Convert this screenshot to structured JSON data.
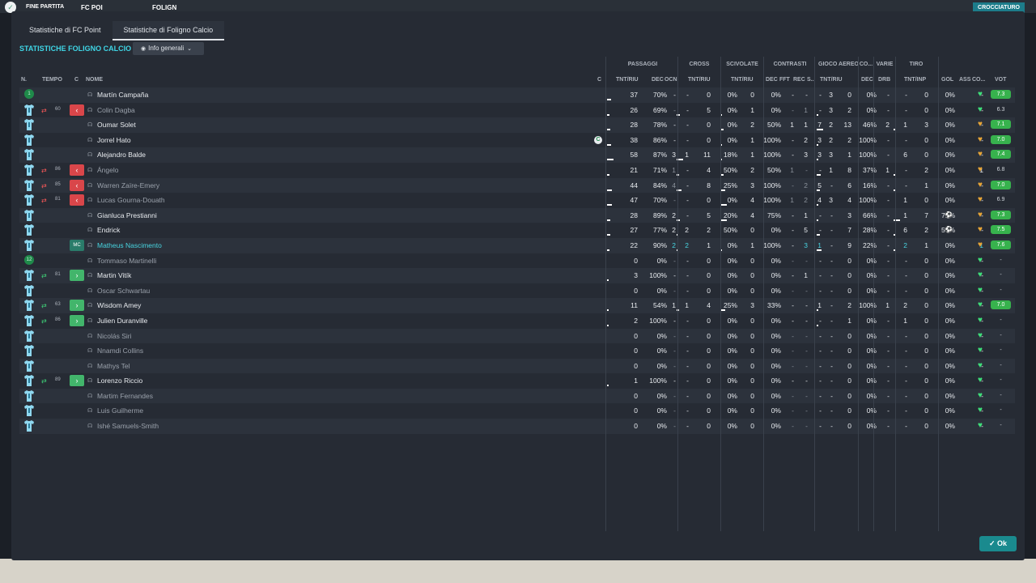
{
  "topbar": {
    "title": "FINE PARTITA",
    "home": "FC POI",
    "score": "",
    "away": "FOLIGN",
    "right_btn": "CROCCIATURO"
  },
  "tabs": [
    {
      "label": "Statistiche di FC Point",
      "active": false
    },
    {
      "label": "Statistiche di Foligno Calcio",
      "active": true
    }
  ],
  "section_title": "STATISTICHE FOLIGNO CALCIO",
  "filter": {
    "label": "Info generali"
  },
  "groups": [
    "PASSAGGI",
    "CROSS",
    "SCIVOLATE",
    "CONTRASTI",
    "GIOCO AEREO",
    "CO...",
    "VARIE",
    "TIRO"
  ],
  "columns": {
    "n": "N.",
    "tempo": "TEMPO",
    "c1": "C",
    "nome": "NOME",
    "c2": "C",
    "tntriu1": "TNT/RIU",
    "dec1": "DEC",
    "ocn": "OCN",
    "tntriu2": "TNT/RIU",
    "tntriu3": "TNT/RIU",
    "dec2": "DEC",
    "fft": "FFT",
    "rec": "REC",
    "s": "S...",
    "tntriu4": "TNT/RIU",
    "dec3": "DEC",
    "drb": "DRB",
    "tntinp": "TNT/INP",
    "gol": "GOL",
    "ass": "ASS",
    "co": "CO...",
    "vot": "VOT"
  },
  "players": [
    {
      "shirt": "gk",
      "gk_no": "1",
      "name": "Martín Campaña",
      "style": "",
      "captain": false,
      "sub": "",
      "min": "",
      "p": "37",
      "pp": "70%",
      "dec": "-",
      "ocn": "-",
      "cr": "0",
      "crp": "0%",
      "sc": "0",
      "scp": "0%",
      "cdec": "-",
      "cfft": "-",
      "crec": "-",
      "cs": "3",
      "ga": "0",
      "gap": "0%",
      "co": "-",
      "drb": "-",
      "t": "0",
      "tp": "0%",
      "gol": "",
      "ass": "-",
      "heart": "g",
      "vot": "7.3",
      "vhi": true
    },
    {
      "shirt": "p",
      "name": "Colin Dagba",
      "style": "dim",
      "captain": false,
      "sub": "out",
      "min": "60",
      "p": "26",
      "pp": "69%",
      "dec": "-",
      "ocn": "-",
      "cr": "5",
      "crp": "0%",
      "sc": "1",
      "scp": "0%",
      "cdec": "-",
      "cfft": "1",
      "crec": "-",
      "cs": "3",
      "ga": "2",
      "gap": "0%",
      "co": "-",
      "drb": "-",
      "t": "0",
      "tp": "0%",
      "gol": "",
      "ass": "-",
      "heart": "g",
      "vot": "6.3",
      "vhi": false
    },
    {
      "shirt": "p",
      "name": "Oumar Solet",
      "style": "",
      "captain": false,
      "sub": "",
      "min": "",
      "p": "28",
      "pp": "78%",
      "dec": "-",
      "ocn": "-",
      "cr": "0",
      "crp": "0%",
      "sc": "2",
      "scp": "50%",
      "cdec": "1",
      "cfft": "1",
      "crec": "7",
      "cs": "2",
      "ga": "13",
      "gap": "46%",
      "co": "2",
      "drb": "1",
      "t": "3",
      "tp": "0%",
      "gol": "",
      "ass": "-",
      "heart": "o",
      "vot": "7.1",
      "vhi": true
    },
    {
      "shirt": "p",
      "name": "Jorrel Hato",
      "style": "",
      "captain": true,
      "sub": "",
      "min": "",
      "p": "38",
      "pp": "86%",
      "dec": "-",
      "ocn": "-",
      "cr": "0",
      "crp": "0%",
      "sc": "1",
      "scp": "100%",
      "cdec": "-",
      "cfft": "2",
      "crec": "3",
      "cs": "2",
      "ga": "2",
      "gap": "100%",
      "co": "-",
      "drb": "-",
      "t": "0",
      "tp": "0%",
      "gol": "",
      "ass": "-",
      "heart": "o",
      "vot": "7.0",
      "vhi": true
    },
    {
      "shirt": "p",
      "name": "Alejandro Balde",
      "style": "",
      "captain": false,
      "sub": "",
      "min": "",
      "p": "58",
      "pp": "87%",
      "dec": "3",
      "ocn": "1",
      "cr": "11",
      "crp": "18%",
      "sc": "1",
      "scp": "100%",
      "cdec": "-",
      "cfft": "3",
      "crec": "3",
      "cs": "3",
      "ga": "1",
      "gap": "100%",
      "co": "-",
      "drb": "6",
      "t": "0",
      "tp": "0%",
      "gol": "",
      "ass": "-",
      "heart": "o",
      "vot": "7.4",
      "vhi": true
    },
    {
      "shirt": "p",
      "name": "Ángelo",
      "style": "dim",
      "captain": false,
      "sub": "out",
      "min": "86",
      "p": "21",
      "pp": "71%",
      "dec": "1",
      "ocn": "-",
      "cr": "4",
      "crp": "50%",
      "sc": "2",
      "scp": "50%",
      "cdec": "1",
      "cfft": "-",
      "crec": "-",
      "cs": "1",
      "ga": "8",
      "gap": "37%",
      "co": "1",
      "drb": "-",
      "t": "2",
      "tp": "0%",
      "gol": "",
      "ass": "1",
      "heart": "o",
      "vot": "6.8",
      "vhi": false
    },
    {
      "shirt": "p",
      "name": "Warren Zaïre-Emery",
      "style": "dim",
      "captain": false,
      "sub": "out",
      "min": "85",
      "p": "44",
      "pp": "84%",
      "dec": "4",
      "ocn": "-",
      "cr": "8",
      "crp": "25%",
      "sc": "3",
      "scp": "100%",
      "cdec": "-",
      "cfft": "2",
      "crec": "5",
      "cs": "-",
      "ga": "6",
      "gap": "16%",
      "co": "-",
      "drb": "-",
      "t": "1",
      "tp": "0%",
      "gol": "",
      "ass": "-",
      "heart": "o",
      "vot": "7.0",
      "vhi": true
    },
    {
      "shirt": "p",
      "name": "Lucas Gourna-Douath",
      "style": "dim",
      "captain": false,
      "sub": "out",
      "min": "81",
      "p": "47",
      "pp": "70%",
      "dec": "-",
      "ocn": "-",
      "cr": "0",
      "crp": "0%",
      "sc": "4",
      "scp": "100%",
      "cdec": "1",
      "cfft": "2",
      "crec": "4",
      "cs": "3",
      "ga": "4",
      "gap": "100%",
      "co": "-",
      "drb": "1",
      "t": "0",
      "tp": "0%",
      "gol": "",
      "ass": "-",
      "heart": "o",
      "vot": "6.9",
      "vhi": false
    },
    {
      "shirt": "p",
      "name": "Gianluca Prestianni",
      "style": "",
      "captain": false,
      "sub": "",
      "min": "",
      "p": "28",
      "pp": "89%",
      "dec": "2",
      "ocn": "-",
      "cr": "5",
      "crp": "20%",
      "sc": "4",
      "scp": "75%",
      "cdec": "-",
      "cfft": "1",
      "crec": "-",
      "cs": "-",
      "ga": "3",
      "gap": "66%",
      "co": "-",
      "drb": "1",
      "t": "7",
      "tp": "71%",
      "gol": "ball",
      "ass": "-",
      "heart": "o",
      "vot": "7.3",
      "vhi": true
    },
    {
      "shirt": "p",
      "name": "Endrick",
      "style": "",
      "captain": false,
      "sub": "",
      "min": "",
      "p": "27",
      "pp": "77%",
      "dec": "2",
      "ocn": "2",
      "cr": "2",
      "crp": "50%",
      "sc": "0",
      "scp": "0%",
      "cdec": "-",
      "cfft": "5",
      "crec": "-",
      "cs": "-",
      "ga": "7",
      "gap": "28%",
      "co": "-",
      "drb": "6",
      "t": "2",
      "tp": "50%",
      "gol": "ball",
      "ass": "-",
      "heart": "o",
      "vot": "7.5",
      "vhi": true
    },
    {
      "shirt": "p",
      "name": "Matheus Nascimento",
      "style": "cyan",
      "captain": false,
      "sub": "mc",
      "min": "",
      "p": "22",
      "pp": "90%",
      "dec": "2",
      "ocn": "2",
      "cr": "1",
      "crp": "0%",
      "sc": "1",
      "scp": "100%",
      "cdec": "-",
      "cfft": "3",
      "crec": "1",
      "cs": "-",
      "ga": "9",
      "gap": "22%",
      "co": "-",
      "drb": "2",
      "t": "1",
      "tp": "0%",
      "gol": "",
      "ass": "1",
      "heart": "o",
      "vot": "7.6",
      "vhi": true
    },
    {
      "shirt": "gk",
      "gk_no": "12",
      "name": "Tommaso Martinelli",
      "style": "dim",
      "captain": false,
      "sub": "",
      "min": "",
      "p": "0",
      "pp": "0%",
      "dec": "-",
      "ocn": "-",
      "cr": "0",
      "crp": "0%",
      "sc": "0",
      "scp": "0%",
      "cdec": "-",
      "cfft": "-",
      "crec": "-",
      "cs": "-",
      "ga": "0",
      "gap": "0%",
      "co": "-",
      "drb": "-",
      "t": "0",
      "tp": "0%",
      "gol": "",
      "ass": "-",
      "heart": "g",
      "vot": "-",
      "vhi": false
    },
    {
      "shirt": "p",
      "name": "Martin Vitík",
      "style": "",
      "captain": false,
      "sub": "in",
      "min": "81",
      "p": "3",
      "pp": "100%",
      "dec": "-",
      "ocn": "-",
      "cr": "0",
      "crp": "0%",
      "sc": "0",
      "scp": "0%",
      "cdec": "-",
      "cfft": "1",
      "crec": "-",
      "cs": "-",
      "ga": "0",
      "gap": "0%",
      "co": "-",
      "drb": "-",
      "t": "0",
      "tp": "0%",
      "gol": "",
      "ass": "-",
      "heart": "g",
      "vot": "-",
      "vhi": false
    },
    {
      "shirt": "p",
      "name": "Oscar Schwartau",
      "style": "dim",
      "captain": false,
      "sub": "",
      "min": "",
      "p": "0",
      "pp": "0%",
      "dec": "-",
      "ocn": "-",
      "cr": "0",
      "crp": "0%",
      "sc": "0",
      "scp": "0%",
      "cdec": "-",
      "cfft": "-",
      "crec": "-",
      "cs": "-",
      "ga": "0",
      "gap": "0%",
      "co": "-",
      "drb": "-",
      "t": "0",
      "tp": "0%",
      "gol": "",
      "ass": "-",
      "heart": "g",
      "vot": "-",
      "vhi": false
    },
    {
      "shirt": "p",
      "name": "Wisdom Amey",
      "style": "",
      "captain": false,
      "sub": "in",
      "min": "63",
      "p": "11",
      "pp": "54%",
      "dec": "1",
      "ocn": "1",
      "cr": "4",
      "crp": "25%",
      "sc": "3",
      "scp": "33%",
      "cdec": "-",
      "cfft": "-",
      "crec": "1",
      "cs": "-",
      "ga": "2",
      "gap": "100%",
      "co": "1",
      "drb": "2",
      "t": "0",
      "tp": "0%",
      "gol": "",
      "ass": "-",
      "heart": "g",
      "vot": "7.0",
      "vhi": true
    },
    {
      "shirt": "p",
      "name": "Julien Duranville",
      "style": "",
      "captain": false,
      "sub": "in",
      "min": "86",
      "p": "2",
      "pp": "100%",
      "dec": "-",
      "ocn": "-",
      "cr": "0",
      "crp": "0%",
      "sc": "0",
      "scp": "0%",
      "cdec": "-",
      "cfft": "-",
      "crec": "-",
      "cs": "-",
      "ga": "1",
      "gap": "0%",
      "co": "-",
      "drb": "1",
      "t": "0",
      "tp": "0%",
      "gol": "",
      "ass": "-",
      "heart": "g",
      "vot": "-",
      "vhi": false
    },
    {
      "shirt": "p",
      "name": "Nicolás Siri",
      "style": "dim",
      "captain": false,
      "sub": "",
      "min": "",
      "p": "0",
      "pp": "0%",
      "dec": "-",
      "ocn": "-",
      "cr": "0",
      "crp": "0%",
      "sc": "0",
      "scp": "0%",
      "cdec": "-",
      "cfft": "-",
      "crec": "-",
      "cs": "-",
      "ga": "0",
      "gap": "0%",
      "co": "-",
      "drb": "-",
      "t": "0",
      "tp": "0%",
      "gol": "",
      "ass": "-",
      "heart": "g",
      "vot": "-",
      "vhi": false
    },
    {
      "shirt": "p",
      "name": "Nnamdi Collins",
      "style": "dim",
      "captain": false,
      "sub": "",
      "min": "",
      "p": "0",
      "pp": "0%",
      "dec": "-",
      "ocn": "-",
      "cr": "0",
      "crp": "0%",
      "sc": "0",
      "scp": "0%",
      "cdec": "-",
      "cfft": "-",
      "crec": "-",
      "cs": "-",
      "ga": "0",
      "gap": "0%",
      "co": "-",
      "drb": "-",
      "t": "0",
      "tp": "0%",
      "gol": "",
      "ass": "-",
      "heart": "g",
      "vot": "-",
      "vhi": false
    },
    {
      "shirt": "p",
      "name": "Mathys Tel",
      "style": "dim",
      "captain": false,
      "sub": "",
      "min": "",
      "p": "0",
      "pp": "0%",
      "dec": "-",
      "ocn": "-",
      "cr": "0",
      "crp": "0%",
      "sc": "0",
      "scp": "0%",
      "cdec": "-",
      "cfft": "-",
      "crec": "-",
      "cs": "-",
      "ga": "0",
      "gap": "0%",
      "co": "-",
      "drb": "-",
      "t": "0",
      "tp": "0%",
      "gol": "",
      "ass": "-",
      "heart": "g",
      "vot": "-",
      "vhi": false
    },
    {
      "shirt": "p",
      "name": "Lorenzo Riccio",
      "style": "",
      "captain": false,
      "sub": "in",
      "min": "89",
      "p": "1",
      "pp": "100%",
      "dec": "-",
      "ocn": "-",
      "cr": "0",
      "crp": "0%",
      "sc": "0",
      "scp": "0%",
      "cdec": "-",
      "cfft": "-",
      "crec": "-",
      "cs": "-",
      "ga": "0",
      "gap": "0%",
      "co": "-",
      "drb": "-",
      "t": "0",
      "tp": "0%",
      "gol": "",
      "ass": "-",
      "heart": "g",
      "vot": "-",
      "vhi": false
    },
    {
      "shirt": "p",
      "name": "Martim Fernandes",
      "style": "dim",
      "captain": false,
      "sub": "",
      "min": "",
      "p": "0",
      "pp": "0%",
      "dec": "-",
      "ocn": "-",
      "cr": "0",
      "crp": "0%",
      "sc": "0",
      "scp": "0%",
      "cdec": "-",
      "cfft": "-",
      "crec": "-",
      "cs": "-",
      "ga": "0",
      "gap": "0%",
      "co": "-",
      "drb": "-",
      "t": "0",
      "tp": "0%",
      "gol": "",
      "ass": "-",
      "heart": "g",
      "vot": "-",
      "vhi": false
    },
    {
      "shirt": "p",
      "name": "Luis Guilherme",
      "style": "dim",
      "captain": false,
      "sub": "",
      "min": "",
      "p": "0",
      "pp": "0%",
      "dec": "-",
      "ocn": "-",
      "cr": "0",
      "crp": "0%",
      "sc": "0",
      "scp": "0%",
      "cdec": "-",
      "cfft": "-",
      "crec": "-",
      "cs": "-",
      "ga": "0",
      "gap": "0%",
      "co": "-",
      "drb": "-",
      "t": "0",
      "tp": "0%",
      "gol": "",
      "ass": "-",
      "heart": "g",
      "vot": "-",
      "vhi": false
    },
    {
      "shirt": "p",
      "name": "Ishé Samuels-Smith",
      "style": "dim",
      "captain": false,
      "sub": "",
      "min": "",
      "p": "0",
      "pp": "0%",
      "dec": "-",
      "ocn": "-",
      "cr": "0",
      "crp": "0%",
      "sc": "0",
      "scp": "0%",
      "cdec": "-",
      "cfft": "-",
      "crec": "-",
      "cs": "-",
      "ga": "0",
      "gap": "0%",
      "co": "-",
      "drb": "-",
      "t": "0",
      "tp": "0%",
      "gol": "",
      "ass": "-",
      "heart": "g",
      "vot": "-",
      "vhi": false
    }
  ],
  "ok_label": "Ok",
  "colors": {
    "accent": "#3fd6e6",
    "vote_high": "#37b24d",
    "sub_out": "#d9464a",
    "sub_in": "#42b56b"
  }
}
